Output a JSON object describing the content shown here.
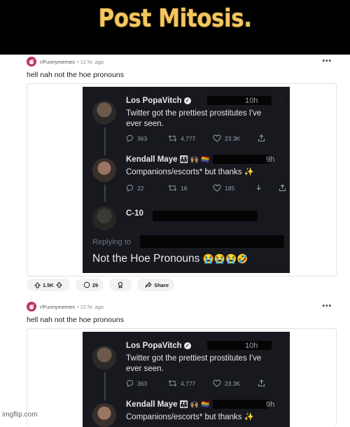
{
  "meme": {
    "title": "Post Mitosis.",
    "watermark": "imgflip.com"
  },
  "posts": [
    {
      "subreddit": "r/Funnymemes",
      "time": "• 12 hr. ago",
      "more": "•••",
      "title": "hell nah not the hoe pronouns",
      "votes": "1.5K",
      "comments": "29",
      "share": "Share"
    },
    {
      "subreddit": "r/Funnymemes",
      "time": "• 12 hr. ago",
      "more": "•••",
      "title": "hell nah not the hoe pronouns"
    }
  ],
  "tweet1": {
    "name": "Los PopaVitch",
    "time": "10h",
    "text1": "Twitter got the prettiest prostitutes I've",
    "text2": "ever seen.",
    "replies": "363",
    "retweets": "4,777",
    "likes": "23.3K"
  },
  "tweet2": {
    "name": "Kendall Maye",
    "emoji": "👨‍👩‍👧 🙌🏽 🏳️‍🌈",
    "time": "9h",
    "text": "Companions/escorts* but thanks ✨",
    "replies": "22",
    "retweets": "16",
    "likes": "185"
  },
  "tweet3": {
    "name": "C-10",
    "replying": "Replying to",
    "text": "Not the Hoe Pronouns",
    "emoji": "😭😭😭🤣"
  },
  "colors": {
    "title_yellow": "#f4c65e",
    "tweet_bg": "#17191f",
    "subreddit_icon": "#c0306a"
  }
}
